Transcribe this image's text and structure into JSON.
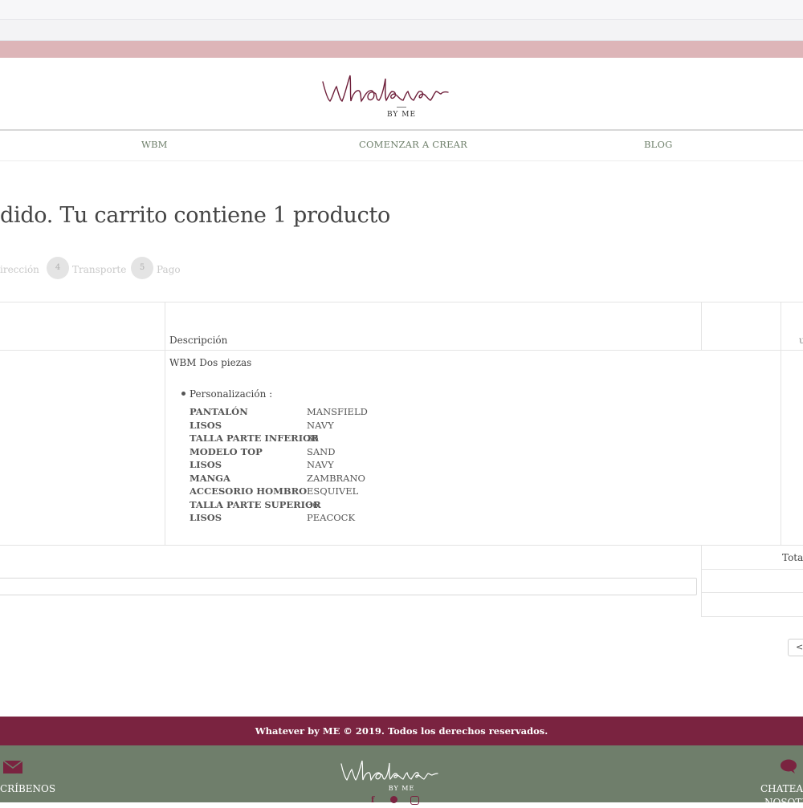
{
  "brand": {
    "logo_script": "Whatever",
    "logo_sub": "BY ME"
  },
  "nav": {
    "items": [
      "WBM",
      "COMENZAR A CREAR",
      "BLOG"
    ]
  },
  "page": {
    "heading": "dido. Tu carrito contiene 1 producto"
  },
  "steps": [
    {
      "label": "irección"
    },
    {
      "number": "4",
      "label": "Transporte"
    },
    {
      "number": "5",
      "label": "Pago"
    }
  ],
  "cart_table": {
    "header_description": "Descripción",
    "header_right_fragment_top": "",
    "header_right_fragment_bottom": "u",
    "product_name": "WBM Dos piezas",
    "customization_label": "Personalización :",
    "customization": [
      {
        "key": "PANTALÓN",
        "value": "MANSFIELD"
      },
      {
        "key": "LISOS",
        "value": "NAVY"
      },
      {
        "key": "TALLA PARTE INFERIOR",
        "value": "36"
      },
      {
        "key": "MODELO TOP",
        "value": "SAND"
      },
      {
        "key": "LISOS",
        "value": "NAVY"
      },
      {
        "key": "MANGA",
        "value": "ZAMBRANO"
      },
      {
        "key": "ACCESORIO HOMBRO",
        "value": "ESQUIVEL"
      },
      {
        "key": "TALLA PARTE SUPERIOR",
        "value": "36"
      },
      {
        "key": "LISOS",
        "value": "PEACOCK"
      }
    ],
    "total_label": "Total",
    "nav_button_fragment": "<"
  },
  "footer": {
    "copyright": "Whatever by ME © 2019. Todos los derechos reservados.",
    "left_label": "CRÍBENOS",
    "right_label_1": "CHATEA C",
    "right_label_2": "NOSOTR",
    "logo_script": "Whatever",
    "logo_sub": "BY ME"
  },
  "colors": {
    "pink_bar": "#ddb5b8",
    "maroon": "#7a2340",
    "sage_green": "#6f7e6b",
    "nav_text": "#6e7f6a",
    "logo_ink": "#6e1f3a"
  },
  "icons": [
    "envelope-icon",
    "chat-bubble-icon",
    "facebook-icon",
    "pinterest-icon",
    "instagram-icon"
  ]
}
